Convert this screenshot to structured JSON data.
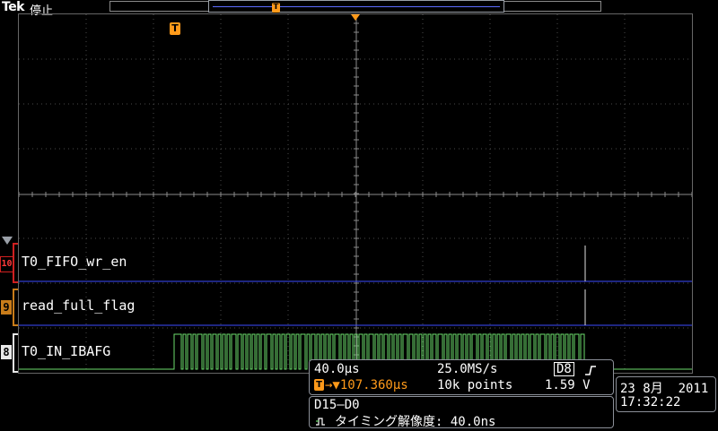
{
  "header": {
    "brand": "Tek",
    "state": "停止",
    "trigger_marker_label": "T"
  },
  "screen": {
    "trigger_flag_label": "T"
  },
  "channels": [
    {
      "badge": "10",
      "name": "T0_FIFO_wr_en",
      "color": "#d02020"
    },
    {
      "badge": "9",
      "name": "read_full_flag",
      "color": "#c87c1a"
    },
    {
      "badge": "8",
      "name": "T0_IN_IBAFG",
      "color": "#ffffff"
    }
  ],
  "acquisition": {
    "horizontal_scale": "40.0µs",
    "sample_rate": "25.0MS/s",
    "trigger_source": "D8",
    "trigger_slope_icon": "rising-edge-icon",
    "trigger_position_label": "T",
    "trigger_position": "→▼107.360µs",
    "record_length": "10k points",
    "trigger_level": "1.59 V"
  },
  "timing": {
    "bus": "D15–D0",
    "resolution_label": "タイミング解像度: 40.0ns",
    "icon": "timing-resolution-icon"
  },
  "datetime": {
    "date": "23 8月  2011",
    "time": "17:32:22"
  },
  "colors": {
    "grid": "#4a4a4a",
    "center_axis": "#8a8a8a",
    "trigger": "#ff9a1a",
    "baseline": "#3c4cff",
    "digital_trace": "#6bdc6b"
  }
}
